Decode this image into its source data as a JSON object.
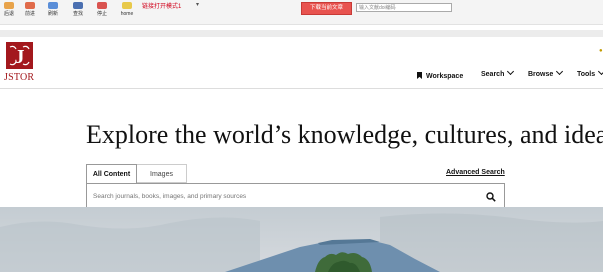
{
  "toolbar": {
    "buttons": [
      {
        "label": "后退",
        "icon": "back-icon",
        "color": "#e8a34a"
      },
      {
        "label": "前进",
        "icon": "forward-icon",
        "color": "#e06b4a"
      },
      {
        "label": "刷新",
        "icon": "refresh-icon",
        "color": "#5a8ed8"
      },
      {
        "label": "查找",
        "icon": "find-icon",
        "color": "#4a6fb0"
      },
      {
        "label": "停止",
        "icon": "stop-icon",
        "color": "#d9534f"
      },
      {
        "label": "home",
        "icon": "home-icon",
        "color": "#e8c94a"
      }
    ],
    "link_mode": "链接打开模式1",
    "download_button": "下载当前文章",
    "id_placeholder": "输入文献doi编码"
  },
  "header": {
    "logo_text": "JSTOR",
    "nav": {
      "workspace": "Workspace",
      "search": "Search",
      "browse": "Browse",
      "tools": "Tools"
    }
  },
  "hero": {
    "headline": "Explore the world’s knowledge, cultures, and ideas",
    "tabs": {
      "all_content": "All Content",
      "images": "Images"
    },
    "advanced_search": "Advanced Search",
    "search_placeholder": "Search journals, books, images, and primary sources"
  },
  "colors": {
    "brand": "#a3181d",
    "download_button": "#e8534f"
  }
}
